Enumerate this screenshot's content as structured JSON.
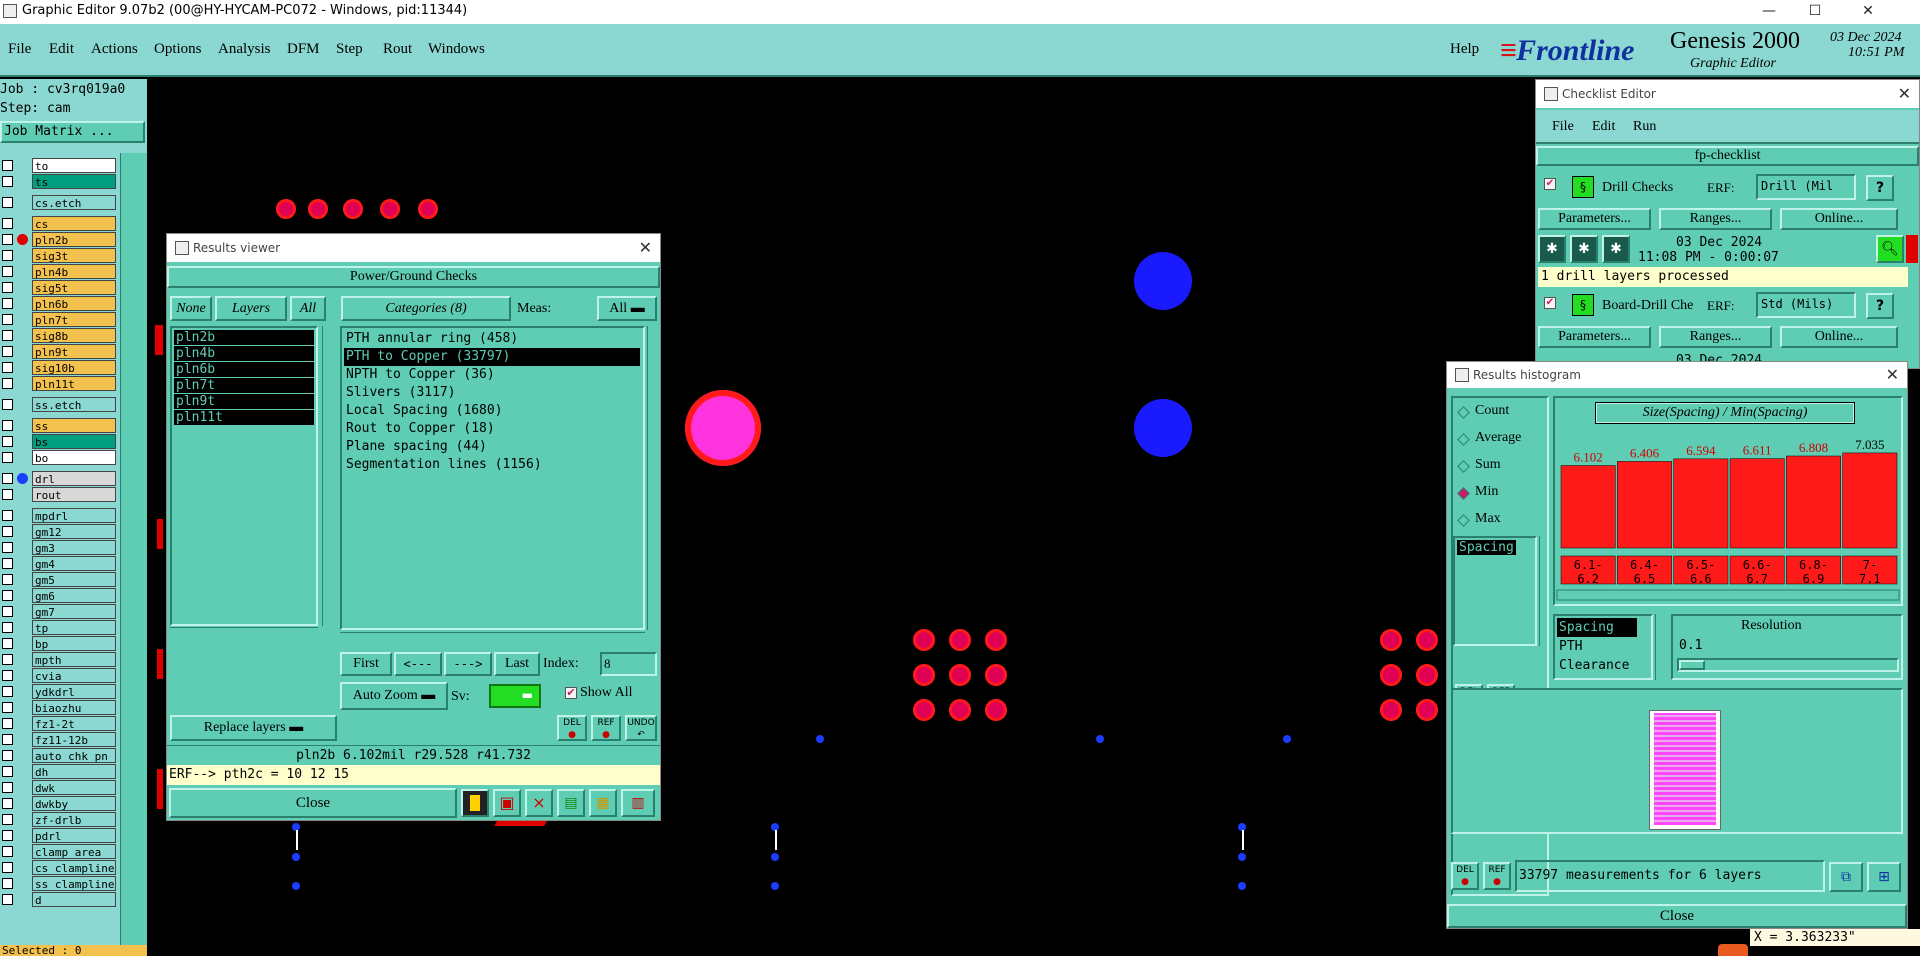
{
  "window": {
    "title": "Graphic Editor 9.07b2 (00@HY-HYCAM-PC072 - Windows, pid:11344)"
  },
  "menu": [
    "File",
    "Edit",
    "Actions",
    "Options",
    "Analysis",
    "DFM",
    "Step",
    "Rout",
    "Windows"
  ],
  "help": "Help",
  "brand": {
    "logo": "Frontline",
    "product": "Genesis 2000",
    "subtitle": "Graphic Editor",
    "date": "03 Dec 2024",
    "time": "10:51 PM"
  },
  "job": {
    "job_label": "Job : cv3rq019a0",
    "step_label": "Step: cam",
    "matrix_button": "Job Matrix ..."
  },
  "layers": [
    {
      "name": "to",
      "color": "#ffffff"
    },
    {
      "name": "ts",
      "color": "#009f7f"
    },
    {
      "name": "cs.etch",
      "color": "#8ad8d1",
      "gap": true
    },
    {
      "name": "cs",
      "color": "#f2c14e",
      "gap": true
    },
    {
      "name": "pln2b",
      "color": "#f2c14e"
    },
    {
      "name": "sig3t",
      "color": "#f2c14e"
    },
    {
      "name": "pln4b",
      "color": "#f2c14e"
    },
    {
      "name": "sig5t",
      "color": "#f2c14e"
    },
    {
      "name": "pln6b",
      "color": "#f2c14e"
    },
    {
      "name": "pln7t",
      "color": "#f2c14e"
    },
    {
      "name": "sig8b",
      "color": "#f2c14e"
    },
    {
      "name": "pln9t",
      "color": "#f2c14e"
    },
    {
      "name": "sig10b",
      "color": "#f2c14e"
    },
    {
      "name": "pln11t",
      "color": "#f2c14e"
    },
    {
      "name": "ss.etch",
      "color": "#8ad8d1",
      "gap": true
    },
    {
      "name": "ss",
      "color": "#f2c14e",
      "gap": true
    },
    {
      "name": "bs",
      "color": "#009f7f"
    },
    {
      "name": "bo",
      "color": "#ffffff"
    },
    {
      "name": "drl",
      "color": "#d8d8d8",
      "gap": true
    },
    {
      "name": "rout",
      "color": "#d8d8d8"
    },
    {
      "name": "mpdrl",
      "color": "#8ad8d1",
      "gap": true
    },
    {
      "name": "gm12",
      "color": "#8ad8d1"
    },
    {
      "name": "gm3",
      "color": "#8ad8d1"
    },
    {
      "name": "gm4",
      "color": "#8ad8d1"
    },
    {
      "name": "gm5",
      "color": "#8ad8d1"
    },
    {
      "name": "gm6",
      "color": "#8ad8d1"
    },
    {
      "name": "gm7",
      "color": "#8ad8d1"
    },
    {
      "name": "tp",
      "color": "#8ad8d1"
    },
    {
      "name": "bp",
      "color": "#8ad8d1"
    },
    {
      "name": "mpth",
      "color": "#8ad8d1"
    },
    {
      "name": "cvia",
      "color": "#8ad8d1"
    },
    {
      "name": "ydkdrl",
      "color": "#8ad8d1"
    },
    {
      "name": "biaozhu",
      "color": "#8ad8d1"
    },
    {
      "name": "fz1-2t",
      "color": "#8ad8d1"
    },
    {
      "name": "fz11-12b",
      "color": "#8ad8d1"
    },
    {
      "name": "auto_chk_pn",
      "color": "#8ad8d1"
    },
    {
      "name": "dh",
      "color": "#8ad8d1"
    },
    {
      "name": "dwk",
      "color": "#8ad8d1"
    },
    {
      "name": "dwkby",
      "color": "#8ad8d1"
    },
    {
      "name": "zf-drlb",
      "color": "#8ad8d1"
    },
    {
      "name": "pdrl",
      "color": "#8ad8d1"
    },
    {
      "name": "clamp_area",
      "color": "#8ad8d1"
    },
    {
      "name": "cs_clampline",
      "color": "#8ad8d1"
    },
    {
      "name": "ss_clampline",
      "color": "#8ad8d1"
    },
    {
      "name": "d",
      "color": "#8ad8d1"
    }
  ],
  "selected_label": "Selected : 0",
  "results_viewer": {
    "title": "Results viewer",
    "header": "Power/Ground Checks",
    "none_btn": "None",
    "layers_btn": "Layers",
    "all_btn": "All",
    "categories_btn": "Categories (8)",
    "meas_label": "Meas:",
    "meas_value": "All",
    "layer_list": [
      "pln2b",
      "pln4b",
      "pln6b",
      "pln7t",
      "pln9t",
      "pln11t"
    ],
    "categories": [
      "PTH annular ring (458)",
      "PTH to Copper (33797)",
      "NPTH to Copper (36)",
      "Slivers (3117)",
      "Local Spacing (1680)",
      "Rout to Copper (18)",
      "Plane spacing (44)",
      "Segmentation lines (1156)"
    ],
    "selected_category": 1,
    "first": "First",
    "prev": "<---",
    "next": "--->",
    "last": "Last",
    "index_label": "Index:",
    "index_value": "8",
    "auto_zoom": "Auto Zoom",
    "sv_label": "Sv:",
    "show_all": "Show All",
    "replace_layers": "Replace layers",
    "del": "DEL",
    "ref": "REF",
    "undo": "UNDO",
    "status": "pln2b 6.102mil  r29.528  r41.732",
    "erf": "ERF--> pth2c = 10 12 15",
    "close": "Close"
  },
  "checklist": {
    "title": "Checklist Editor",
    "menu": [
      "File",
      "Edit",
      "Run"
    ],
    "name": "fp-checklist",
    "item1": {
      "name": "Drill Checks",
      "erf_label": "ERF:",
      "erf_value": "Drill (Mil",
      "params": "Parameters...",
      "ranges": "Ranges...",
      "online": "Online...",
      "date": "03 Dec 2024",
      "time": "11:08 PM - 0:00:07",
      "msg": "1 drill layers processed"
    },
    "item2": {
      "name": "Board-Drill Che",
      "erf_label": "ERF:",
      "erf_value": "Std (Mils)",
      "params": "Parameters...",
      "ranges": "Ranges...",
      "online": "Online...",
      "date": "03 Dec 2024"
    }
  },
  "histogram": {
    "title": "Results histogram",
    "modes": [
      "Count",
      "Average",
      "Sum",
      "Min",
      "Max"
    ],
    "selected_mode": "Min",
    "chart_title": "Size(Spacing) / Min(Spacing)",
    "list1": [
      "Spacing"
    ],
    "list2": [
      "Spacing",
      "PTH",
      "Clearance"
    ],
    "resolution_label": "Resolution",
    "resolution_value": "0.1",
    "summary": "33797 measurements for 6 layers",
    "del": "DEL",
    "ref": "REF",
    "close": "Close",
    "coord": "X = 3.363233\""
  },
  "chart_data": {
    "type": "bar",
    "title": "Size(Spacing) / Min(Spacing)",
    "categories": [
      "6.1-6.2",
      "6.4-6.5",
      "6.5-6.6",
      "6.6-6.7",
      "6.8-6.9",
      "7-7.1"
    ],
    "values": [
      6.102,
      6.406,
      6.594,
      6.611,
      6.808,
      7.035
    ],
    "value_labels": [
      "6.102",
      "6.406",
      "6.594",
      "6.611",
      "6.808",
      "7.035"
    ],
    "bar_color": "#ff1a1a",
    "ylim": [
      0,
      7.4
    ]
  }
}
